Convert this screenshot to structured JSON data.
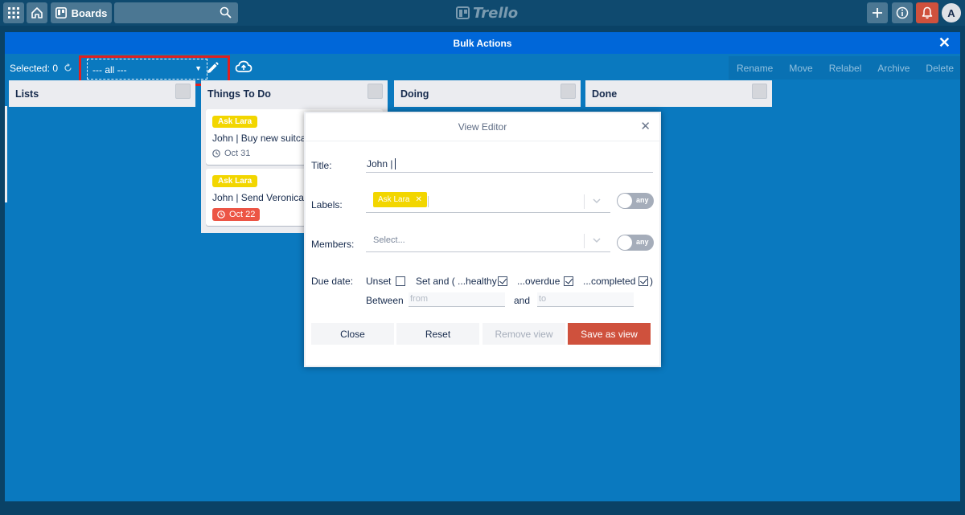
{
  "header": {
    "boards_label": "Boards",
    "logo_text": "Trello",
    "avatar_initial": "A"
  },
  "bulk": {
    "title": "Bulk Actions",
    "selected_label": "Selected: 0",
    "view_select_value": "--- all ---",
    "actions": [
      "Rename",
      "Move",
      "Relabel",
      "Archive",
      "Delete"
    ]
  },
  "lists": [
    {
      "name": "Lists"
    },
    {
      "name": "Things To Do"
    },
    {
      "name": "Doing"
    },
    {
      "name": "Done"
    }
  ],
  "cards": [
    {
      "label": "Ask Lara",
      "title": "John | Buy new suitcas",
      "due": "Oct 31",
      "overdue": false
    },
    {
      "label": "Ask Lara",
      "title": "John | Send Veronica t",
      "due": "Oct 22",
      "overdue": true
    }
  ],
  "modal": {
    "title": "View Editor",
    "title_label": "Title:",
    "title_value": "John |",
    "labels_label": "Labels:",
    "labels_selected": "Ask Lara",
    "labels_toggle": "any",
    "members_label": "Members:",
    "members_placeholder": "Select...",
    "members_toggle": "any",
    "due_label": "Due date:",
    "unset_label": "Unset",
    "set_and_label": "Set and ( ...healthy",
    "overdue_label": "...overdue",
    "completed_label": "...completed",
    "close_paren": ")",
    "between_label": "Between",
    "from_placeholder": "from",
    "and_label": "and",
    "to_placeholder": "to",
    "buttons": {
      "close": "Close",
      "reset": "Reset",
      "remove": "Remove view",
      "save": "Save as view"
    }
  },
  "colors": {
    "header_bg": "#0f4a6f",
    "overlay_bg": "#0a79bf",
    "overlay_header_bg": "#0067d9",
    "label_yellow": "#f2d600",
    "overdue_red": "#ec5545",
    "primary_button": "#cf513d",
    "highlight_frame": "#e02020"
  }
}
